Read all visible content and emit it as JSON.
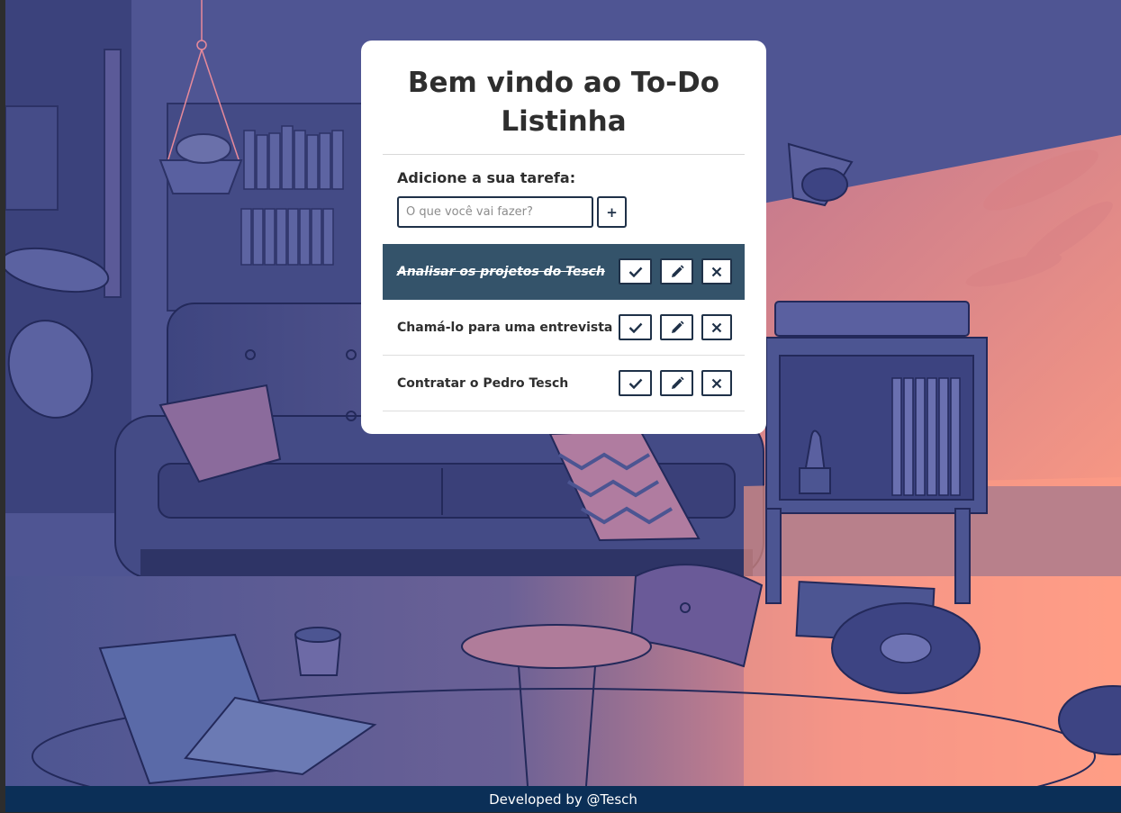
{
  "header": {
    "title": "Bem vindo ao To-Do Listinha"
  },
  "form": {
    "label": "Adicione a sua tarefa:",
    "placeholder": "O que você vai fazer?",
    "value": "",
    "add_label": "+"
  },
  "todos": [
    {
      "title": "Analisar os projetos do Tesch",
      "done": true
    },
    {
      "title": "Chamá-lo para uma entrevista",
      "done": false
    },
    {
      "title": "Contratar o Pedro Tesch",
      "done": false
    }
  ],
  "icons": {
    "finish": "check-icon",
    "edit": "pencil-icon",
    "remove": "close-icon"
  },
  "colors": {
    "accent": "#1f3148",
    "done_row": "#34536a",
    "footer": "#0b2f57"
  },
  "footer": {
    "text": "Developed by @Tesch"
  }
}
